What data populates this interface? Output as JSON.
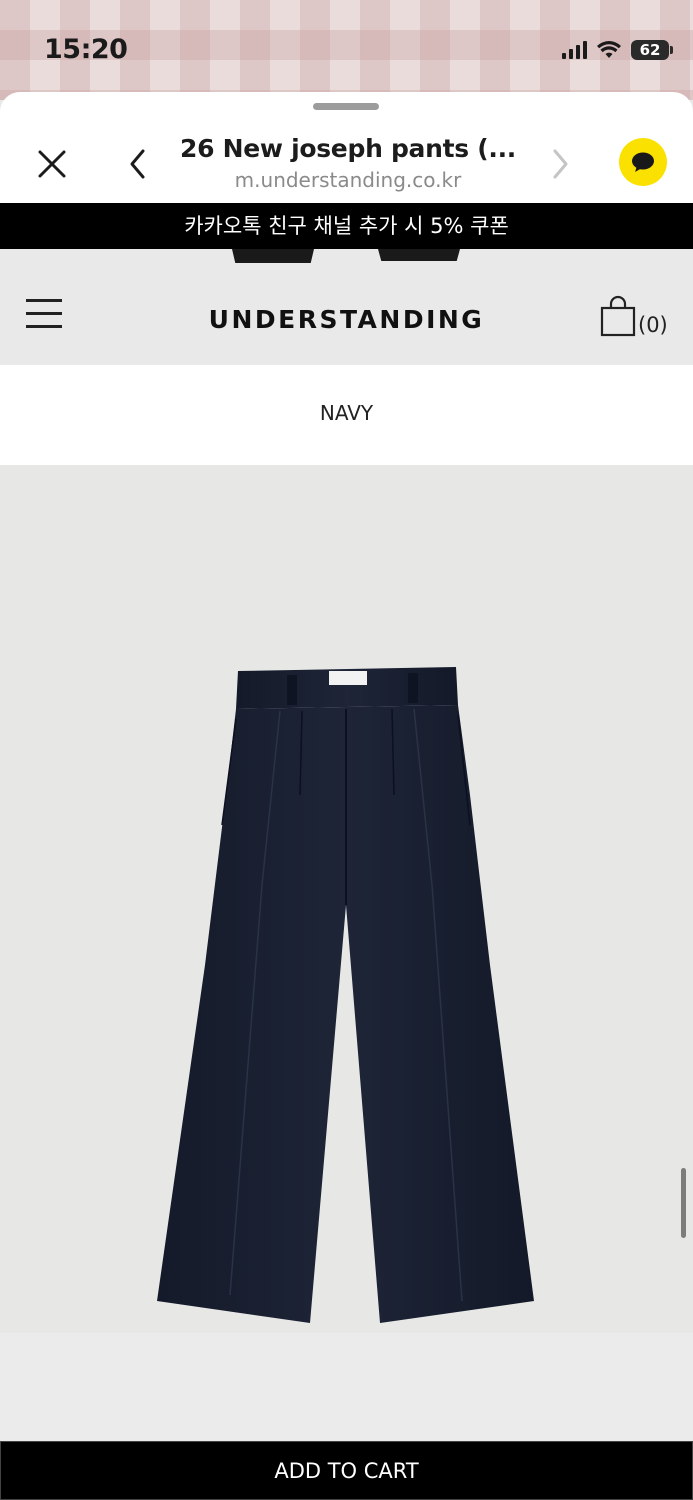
{
  "status_bar": {
    "time": "15:20",
    "battery": "62"
  },
  "browser": {
    "title": "26 New joseph pants (...",
    "url": "m.understanding.co.kr"
  },
  "banner": {
    "text": "카카오톡 친구 채널 추가 시 5% 쿠폰"
  },
  "header": {
    "logo": "UNDERSTANDING",
    "cart_count": "(0)"
  },
  "product": {
    "color_label": "NAVY",
    "color_hex": "#1c2230"
  },
  "footer": {
    "add_to_cart_label": "ADD TO CART"
  },
  "colors": {
    "kakao_yellow": "#fae100",
    "banner_bg": "#000000",
    "header_bg": "#e9e9e9"
  }
}
